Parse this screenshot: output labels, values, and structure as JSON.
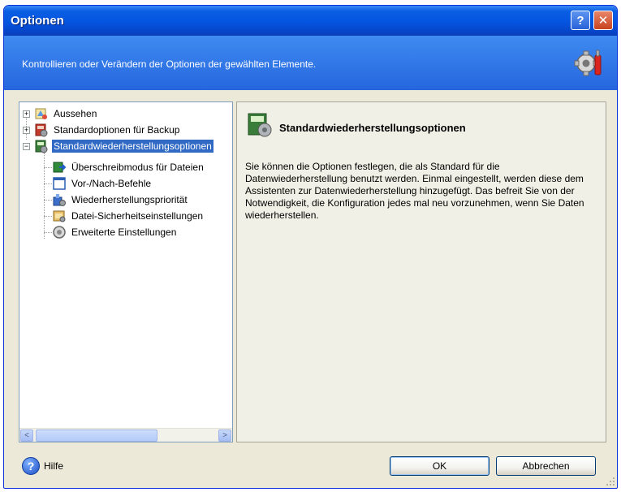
{
  "window": {
    "title": "Optionen",
    "help_button": "?",
    "close_button": "✕"
  },
  "banner": {
    "text": "Kontrollieren oder Verändern der Optionen der gewählten Elemente."
  },
  "tree": {
    "items": [
      {
        "label": "Aussehen",
        "icon": "appearance-icon",
        "expander": "+"
      },
      {
        "label": "Standardoptionen für Backup",
        "icon": "backup-icon",
        "expander": "+"
      },
      {
        "label": "Standardwiederherstellungsoptionen",
        "icon": "recovery-icon",
        "expander": "−",
        "selected": true
      },
      {
        "label": "Überschreibmodus für Dateien",
        "icon": "overwrite-icon"
      },
      {
        "label": "Vor-/Nach-Befehle",
        "icon": "commands-icon"
      },
      {
        "label": "Wiederherstellungspriorität",
        "icon": "priority-icon"
      },
      {
        "label": "Datei-Sicherheitseinstellungen",
        "icon": "security-icon"
      },
      {
        "label": "Erweiterte Einstellungen",
        "icon": "advanced-settings-icon"
      }
    ],
    "scroll_left": "<",
    "scroll_right": ">"
  },
  "content": {
    "title": "Standardwiederherstellungsoptionen",
    "description": "Sie können die Optionen festlegen, die als Standard  für die Datenwiederherstellung benutzt werden. Einmal eingestellt, werden diese dem Assistenten zur Datenwiederherstellung hinzugefügt. Das befreit Sie von der Notwendigkeit, die Konfiguration jedes mal neu vorzunehmen, wenn Sie Daten wiederherstellen."
  },
  "footer": {
    "help_label": "Hilfe",
    "ok_label": "OK",
    "cancel_label": "Abbrechen"
  },
  "colors": {
    "titlebar": "#0554e0",
    "banner": "#2f74e6",
    "selection": "#316ac5",
    "dialog_bg": "#ece9d8"
  }
}
